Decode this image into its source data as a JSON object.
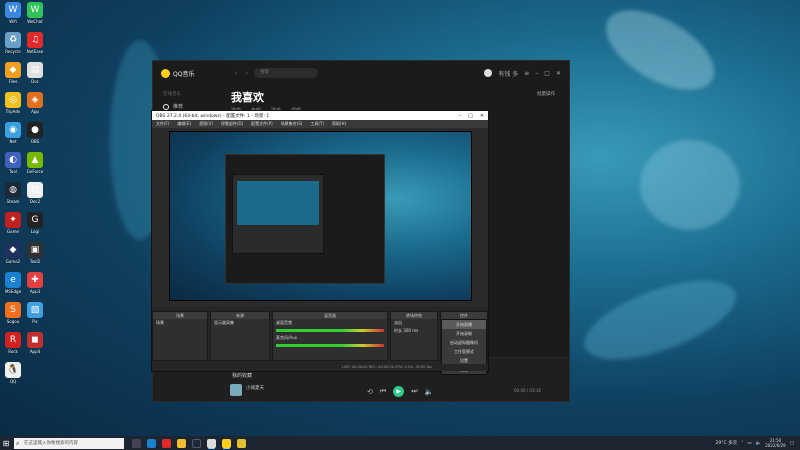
{
  "desktop": {
    "icons": [
      {
        "label": "Wifi",
        "color": "#3a86e0",
        "glyph": "W"
      },
      {
        "label": "WeChat",
        "color": "#2ec45a",
        "glyph": "W"
      },
      {
        "label": "Recycle",
        "color": "#6aa0c8",
        "glyph": "♻"
      },
      {
        "label": "NetEase",
        "color": "#e02a2a",
        "glyph": "♫"
      },
      {
        "label": "Files",
        "color": "#f0a020",
        "glyph": "◆"
      },
      {
        "label": "Doc",
        "color": "#e0e0e0",
        "glyph": "▤"
      },
      {
        "label": "TripAdv",
        "color": "#f0c020",
        "glyph": "◎"
      },
      {
        "label": "App",
        "color": "#e07020",
        "glyph": "◈"
      },
      {
        "label": "Net",
        "color": "#3aa0e0",
        "glyph": "◉"
      },
      {
        "label": "OBS",
        "color": "#222222",
        "glyph": "●"
      },
      {
        "label": "Tool",
        "color": "#4060c0",
        "glyph": "◐"
      },
      {
        "label": "GeForce",
        "color": "#76b900",
        "glyph": "▲"
      },
      {
        "label": "Steam",
        "color": "#1b2838",
        "glyph": "◍"
      },
      {
        "label": "Doc2",
        "color": "#f0f0f0",
        "glyph": "▤"
      },
      {
        "label": "Game",
        "color": "#c02020",
        "glyph": "✦"
      },
      {
        "label": "Logi",
        "color": "#222222",
        "glyph": "G"
      },
      {
        "label": "Game2",
        "color": "#203060",
        "glyph": "◆"
      },
      {
        "label": "Tool2",
        "color": "#303030",
        "glyph": "▣"
      },
      {
        "label": "MSEdge",
        "color": "#1a80d0",
        "glyph": "e"
      },
      {
        "label": "App3",
        "color": "#e04040",
        "glyph": "✚"
      },
      {
        "label": "Sogou",
        "color": "#f07020",
        "glyph": "S"
      },
      {
        "label": "Pic",
        "color": "#40a0e0",
        "glyph": "▧"
      },
      {
        "label": "Rock",
        "color": "#d02020",
        "glyph": "R"
      },
      {
        "label": "App4",
        "color": "#c03030",
        "glyph": "◼"
      },
      {
        "label": "QQ",
        "color": "#f0f0f0",
        "glyph": "🐧"
      }
    ]
  },
  "qq": {
    "logo": "QQ音乐",
    "nav_back": "‹",
    "nav_fwd": "›",
    "search_placeholder": "搜索",
    "user": "有钱 多",
    "sidebar_section": "在线音乐",
    "sidebar_item": "推荐",
    "title": "我喜欢",
    "tabs": [
      "歌曲",
      "专辑",
      "歌单",
      "视频"
    ],
    "batch": "批量操作",
    "now_playing": "我的收藏",
    "song": "小城夏天",
    "play_time": "00:00 / 03:16"
  },
  "obs": {
    "title": "OBS 27.2.4 (64-bit, windows) - 配置文件: 1 - 场景: 1",
    "menus": [
      "文件(F)",
      "编辑(E)",
      "视图(V)",
      "停靠部件(D)",
      "配置文件(P)",
      "场景集合(S)",
      "工具(T)",
      "帮助(H)"
    ],
    "docks": {
      "scenes": "场景",
      "sources": "来源",
      "mixer": "混音器",
      "transitions": "转场特效",
      "controls": "控件"
    },
    "scene_item": "场景",
    "source_item": "显示器采集",
    "mixer_tracks": [
      "桌面音频",
      "麦克风/Aux"
    ],
    "transition": "淡出",
    "duration_label": "时长",
    "duration_value": "300 ms",
    "controls_menu": [
      "开始直播",
      "开始录制",
      "启动虚拟摄像机",
      "工作室模式",
      "设置",
      "退出"
    ],
    "status": "LIVE: 00:00:00   REC: 00:00:00   CPU: 1.0%, 30.00 fps"
  },
  "taskbar": {
    "search_placeholder": "在这里输入你要搜索的内容",
    "weather": "29°C 多云",
    "time": "21:50",
    "date": "2022/6/29"
  }
}
